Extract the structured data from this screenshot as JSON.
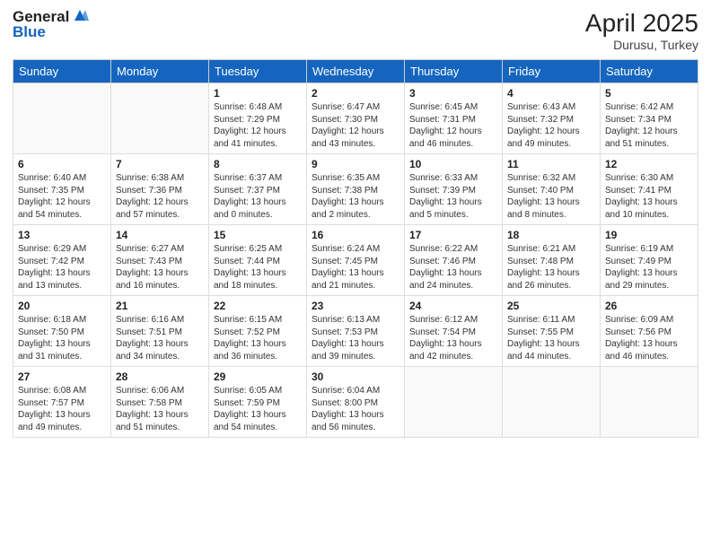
{
  "header": {
    "logo_general": "General",
    "logo_blue": "Blue",
    "title": "April 2025",
    "subtitle": "Durusu, Turkey"
  },
  "weekdays": [
    "Sunday",
    "Monday",
    "Tuesday",
    "Wednesday",
    "Thursday",
    "Friday",
    "Saturday"
  ],
  "weeks": [
    [
      {
        "day": "",
        "info": ""
      },
      {
        "day": "",
        "info": ""
      },
      {
        "day": "1",
        "info": "Sunrise: 6:48 AM\nSunset: 7:29 PM\nDaylight: 12 hours and 41 minutes."
      },
      {
        "day": "2",
        "info": "Sunrise: 6:47 AM\nSunset: 7:30 PM\nDaylight: 12 hours and 43 minutes."
      },
      {
        "day": "3",
        "info": "Sunrise: 6:45 AM\nSunset: 7:31 PM\nDaylight: 12 hours and 46 minutes."
      },
      {
        "day": "4",
        "info": "Sunrise: 6:43 AM\nSunset: 7:32 PM\nDaylight: 12 hours and 49 minutes."
      },
      {
        "day": "5",
        "info": "Sunrise: 6:42 AM\nSunset: 7:34 PM\nDaylight: 12 hours and 51 minutes."
      }
    ],
    [
      {
        "day": "6",
        "info": "Sunrise: 6:40 AM\nSunset: 7:35 PM\nDaylight: 12 hours and 54 minutes."
      },
      {
        "day": "7",
        "info": "Sunrise: 6:38 AM\nSunset: 7:36 PM\nDaylight: 12 hours and 57 minutes."
      },
      {
        "day": "8",
        "info": "Sunrise: 6:37 AM\nSunset: 7:37 PM\nDaylight: 13 hours and 0 minutes."
      },
      {
        "day": "9",
        "info": "Sunrise: 6:35 AM\nSunset: 7:38 PM\nDaylight: 13 hours and 2 minutes."
      },
      {
        "day": "10",
        "info": "Sunrise: 6:33 AM\nSunset: 7:39 PM\nDaylight: 13 hours and 5 minutes."
      },
      {
        "day": "11",
        "info": "Sunrise: 6:32 AM\nSunset: 7:40 PM\nDaylight: 13 hours and 8 minutes."
      },
      {
        "day": "12",
        "info": "Sunrise: 6:30 AM\nSunset: 7:41 PM\nDaylight: 13 hours and 10 minutes."
      }
    ],
    [
      {
        "day": "13",
        "info": "Sunrise: 6:29 AM\nSunset: 7:42 PM\nDaylight: 13 hours and 13 minutes."
      },
      {
        "day": "14",
        "info": "Sunrise: 6:27 AM\nSunset: 7:43 PM\nDaylight: 13 hours and 16 minutes."
      },
      {
        "day": "15",
        "info": "Sunrise: 6:25 AM\nSunset: 7:44 PM\nDaylight: 13 hours and 18 minutes."
      },
      {
        "day": "16",
        "info": "Sunrise: 6:24 AM\nSunset: 7:45 PM\nDaylight: 13 hours and 21 minutes."
      },
      {
        "day": "17",
        "info": "Sunrise: 6:22 AM\nSunset: 7:46 PM\nDaylight: 13 hours and 24 minutes."
      },
      {
        "day": "18",
        "info": "Sunrise: 6:21 AM\nSunset: 7:48 PM\nDaylight: 13 hours and 26 minutes."
      },
      {
        "day": "19",
        "info": "Sunrise: 6:19 AM\nSunset: 7:49 PM\nDaylight: 13 hours and 29 minutes."
      }
    ],
    [
      {
        "day": "20",
        "info": "Sunrise: 6:18 AM\nSunset: 7:50 PM\nDaylight: 13 hours and 31 minutes."
      },
      {
        "day": "21",
        "info": "Sunrise: 6:16 AM\nSunset: 7:51 PM\nDaylight: 13 hours and 34 minutes."
      },
      {
        "day": "22",
        "info": "Sunrise: 6:15 AM\nSunset: 7:52 PM\nDaylight: 13 hours and 36 minutes."
      },
      {
        "day": "23",
        "info": "Sunrise: 6:13 AM\nSunset: 7:53 PM\nDaylight: 13 hours and 39 minutes."
      },
      {
        "day": "24",
        "info": "Sunrise: 6:12 AM\nSunset: 7:54 PM\nDaylight: 13 hours and 42 minutes."
      },
      {
        "day": "25",
        "info": "Sunrise: 6:11 AM\nSunset: 7:55 PM\nDaylight: 13 hours and 44 minutes."
      },
      {
        "day": "26",
        "info": "Sunrise: 6:09 AM\nSunset: 7:56 PM\nDaylight: 13 hours and 46 minutes."
      }
    ],
    [
      {
        "day": "27",
        "info": "Sunrise: 6:08 AM\nSunset: 7:57 PM\nDaylight: 13 hours and 49 minutes."
      },
      {
        "day": "28",
        "info": "Sunrise: 6:06 AM\nSunset: 7:58 PM\nDaylight: 13 hours and 51 minutes."
      },
      {
        "day": "29",
        "info": "Sunrise: 6:05 AM\nSunset: 7:59 PM\nDaylight: 13 hours and 54 minutes."
      },
      {
        "day": "30",
        "info": "Sunrise: 6:04 AM\nSunset: 8:00 PM\nDaylight: 13 hours and 56 minutes."
      },
      {
        "day": "",
        "info": ""
      },
      {
        "day": "",
        "info": ""
      },
      {
        "day": "",
        "info": ""
      }
    ]
  ]
}
